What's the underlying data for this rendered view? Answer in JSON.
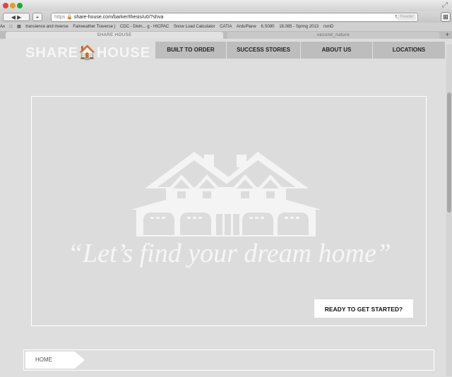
{
  "browser": {
    "url_protocol": "https",
    "url": "share-house.com/barker/thesis/u0/?shva",
    "reader_label": "Reader",
    "reload_glyph": "↻",
    "back_glyph": "◀ ▶",
    "add_glyph": "+",
    "sidebar_glyph": "⊞",
    "bookmarks": [
      "Aᴀ",
      "□",
      "▦",
      "transience and inverse",
      "Fairweather Traverse |",
      "CDC - Divin... g - HICPAC",
      "Snow Load Calculator",
      "CATIA",
      "ArduPlane",
      "6.S080",
      "18.085 - Spring 2013",
      "rsmD"
    ],
    "tabs": [
      {
        "label": "SHARE HOUSE"
      },
      {
        "label": "second_nature"
      }
    ],
    "new_tab_glyph": "+",
    "resize_glyph": "⤢"
  },
  "site": {
    "logo": "SHARE🏠HOUSE",
    "nav": [
      {
        "label": "BUILT TO ORDER"
      },
      {
        "label": "SUCCESS STORIES"
      },
      {
        "label": "ABOUT US"
      },
      {
        "label": "LOCATIONS"
      }
    ],
    "hero": {
      "tagline": "“Let’s find your dream home”",
      "cta_label": "READY TO GET STARTED?",
      "icon": "house-icon"
    },
    "breadcrumb": {
      "items": [
        {
          "label": "HOME"
        }
      ]
    }
  },
  "colors": {
    "page_bg": "#dedede",
    "nav_bg": "#bdbdbd",
    "hero_text": "#f6f6f6"
  }
}
